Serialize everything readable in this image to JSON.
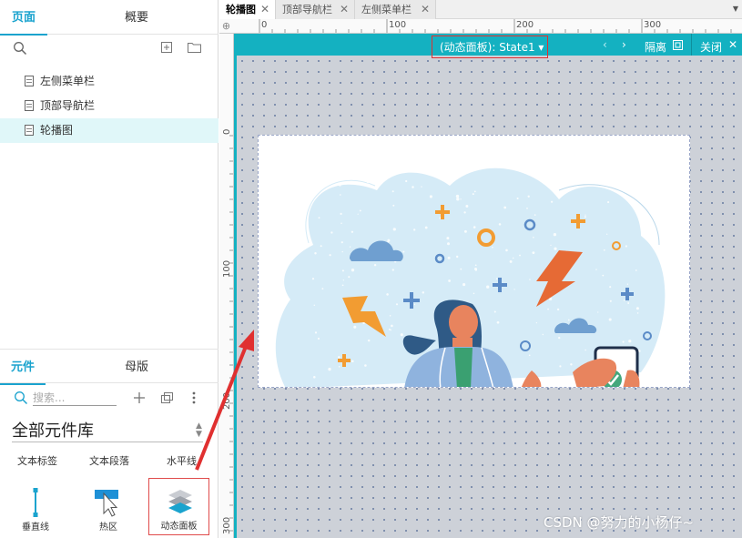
{
  "left_panel": {
    "top_tabs": {
      "pages": "页面",
      "outline": "概要"
    },
    "pages": [
      "左侧菜单栏",
      "顶部导航栏",
      "轮播图"
    ],
    "bottom_tabs": {
      "widgets": "元件",
      "masters": "母版"
    },
    "search_placeholder": "搜索...",
    "library_name": "全部元件库",
    "row1": [
      "文本标签",
      "文本段落",
      "水平线"
    ],
    "widgets": [
      "垂直线",
      "热区",
      "动态面板"
    ]
  },
  "doc_tabs": [
    "轮播图",
    "顶部导航栏",
    "左侧菜单栏"
  ],
  "ruler": {
    "top": [
      "0",
      "100",
      "200",
      "300"
    ],
    "left": [
      "0",
      "100",
      "200",
      "300"
    ]
  },
  "state_bar": {
    "state_label": "(动态面板): State1 ▾",
    "prev": "‹",
    "next": "›",
    "isolate": "隔离",
    "close": "关闭"
  },
  "watermark": "CSDN @努力的小杨仔~",
  "colors": {
    "accent": "#14b1c1",
    "tab_active": "#1aa3ce",
    "annotation": "#e03030"
  }
}
